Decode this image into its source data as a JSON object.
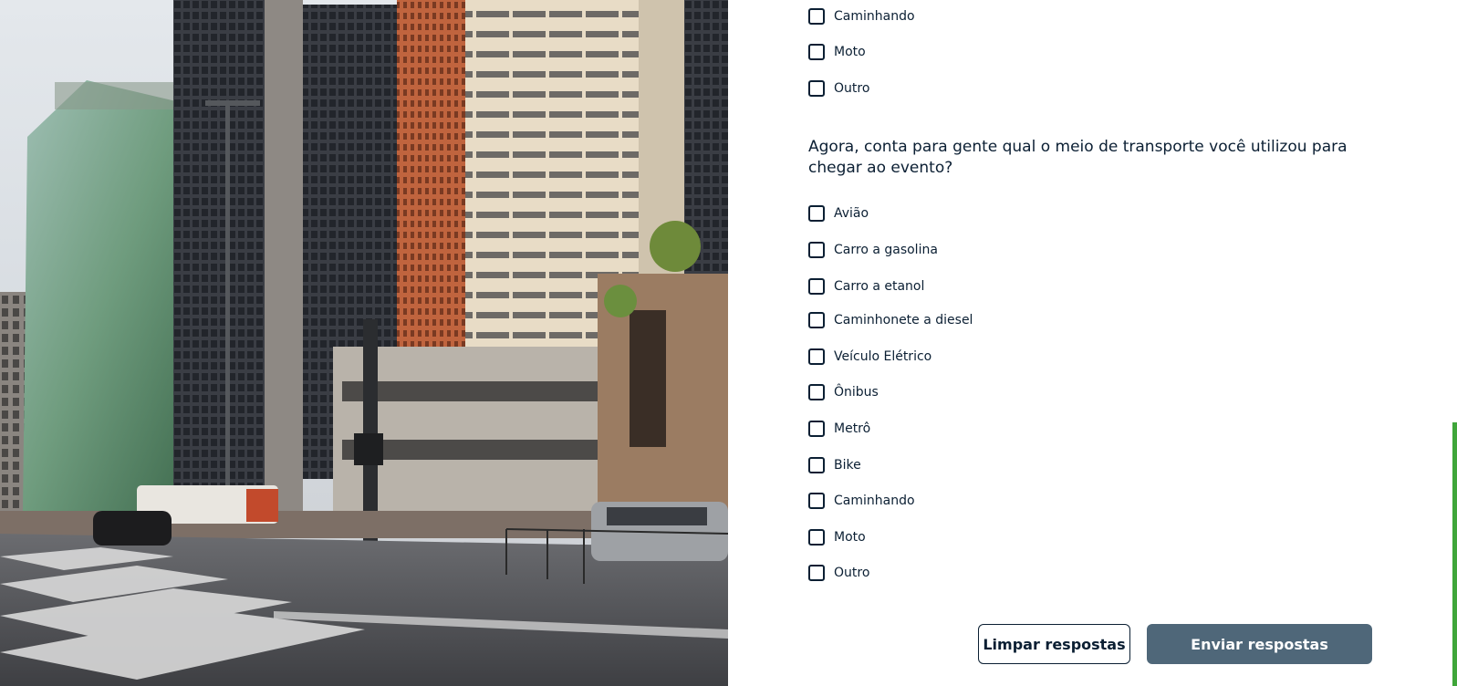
{
  "first_question_options_tail": [
    {
      "label": "Caminhando",
      "checked": false
    },
    {
      "label": "Moto",
      "checked": false
    },
    {
      "label": "Outro",
      "checked": false
    }
  ],
  "question": {
    "text": "Agora, conta para gente qual o meio de transporte você utilizou para chegar ao evento?"
  },
  "options": [
    {
      "label": "Avião",
      "checked": false
    },
    {
      "label": "Carro a gasolina",
      "checked": false
    },
    {
      "label": "Carro a etanol",
      "checked": false
    },
    {
      "label": "Caminhonete a diesel",
      "checked": false
    },
    {
      "label": "Veículo Elétrico",
      "checked": false
    },
    {
      "label": "Ônibus",
      "checked": false
    },
    {
      "label": "Metrô",
      "checked": false
    },
    {
      "label": "Bike",
      "checked": false
    },
    {
      "label": "Caminhando",
      "checked": false
    },
    {
      "label": "Moto",
      "checked": false
    },
    {
      "label": "Outro",
      "checked": false
    }
  ],
  "buttons": {
    "clear_label": "Limpar respostas",
    "submit_label": "Enviar respostas"
  },
  "colors": {
    "text": "#0b1f33",
    "submit_button": "#4f6779",
    "scroll_thumb": "#3fa63a"
  }
}
